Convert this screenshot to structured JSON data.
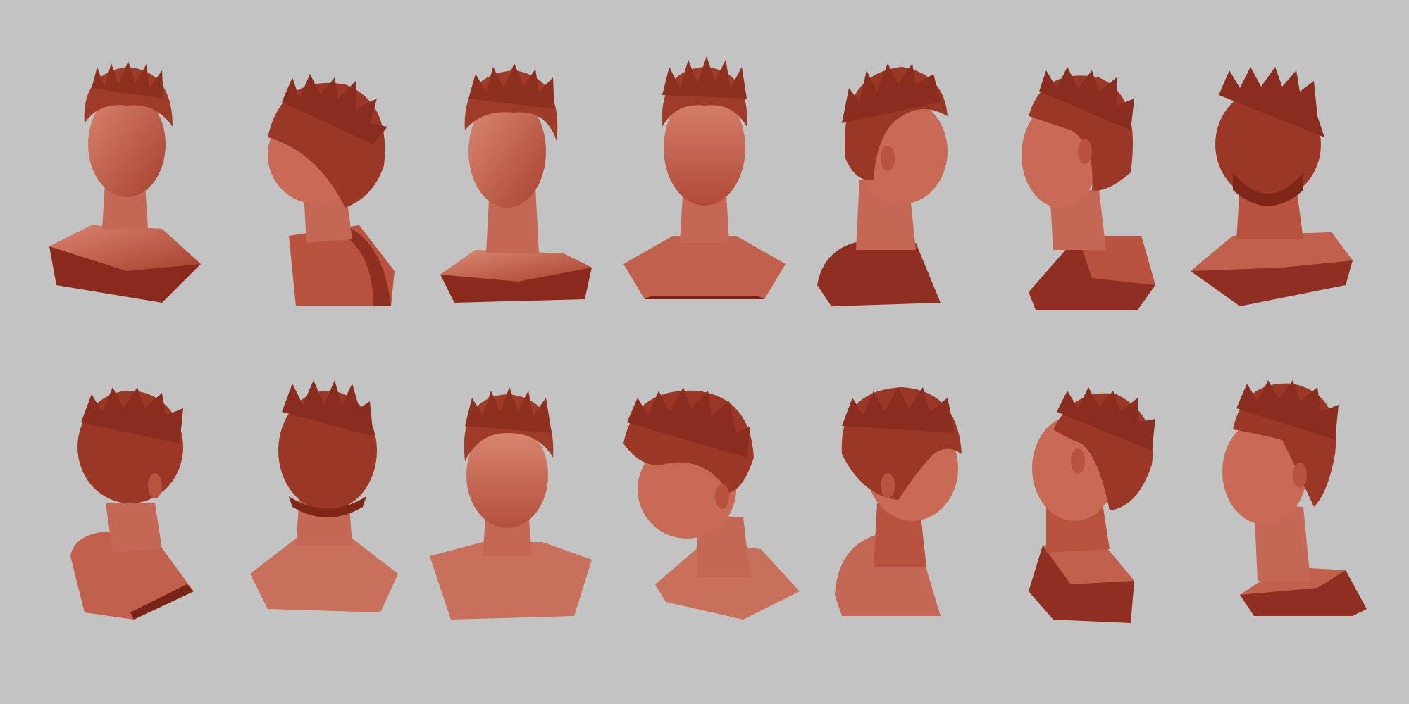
{
  "scene": {
    "background_color": "#c3c3c3",
    "clay_colors": {
      "skin_light": "#d07a66",
      "skin_mid": "#b9523f",
      "skin_dark": "#8f2f22",
      "base_shadow": "#7a2416",
      "hair": "#a8402d",
      "hair_dark": "#6e1e12"
    },
    "rows": [
      {
        "views": [
          {
            "view": "front-left-tilt"
          },
          {
            "view": "left-profile-back"
          },
          {
            "view": "three-quarter-left"
          },
          {
            "view": "front"
          },
          {
            "view": "right-profile"
          },
          {
            "view": "left-three-quarter-back"
          },
          {
            "view": "back-right"
          }
        ]
      },
      {
        "views": [
          {
            "view": "back-left"
          },
          {
            "view": "back"
          },
          {
            "view": "front-down"
          },
          {
            "view": "three-quarter-down"
          },
          {
            "view": "right-three-quarter"
          },
          {
            "view": "left-back-profile"
          },
          {
            "view": "left-profile"
          }
        ]
      }
    ]
  }
}
